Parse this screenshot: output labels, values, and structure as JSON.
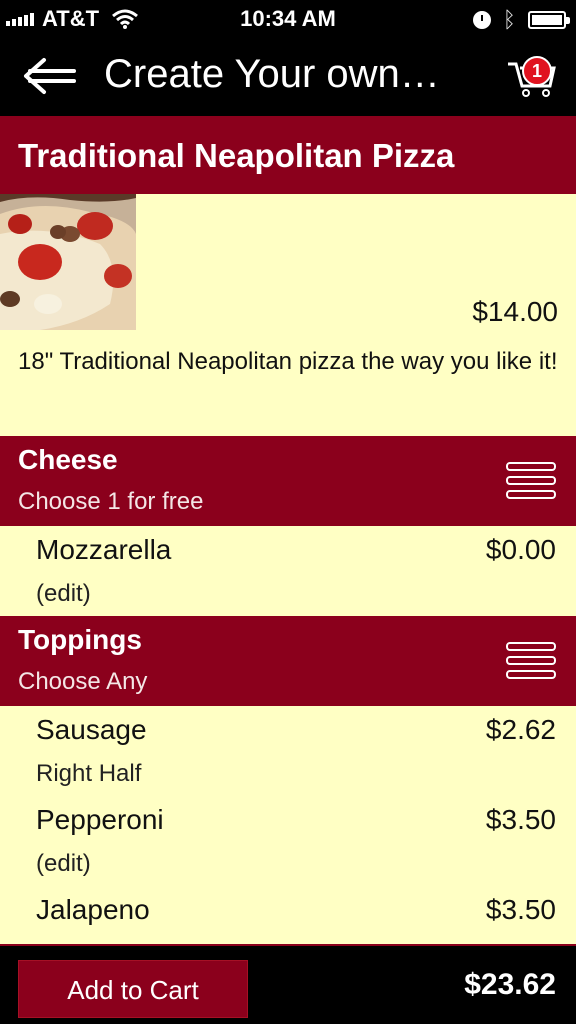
{
  "status_bar": {
    "carrier": "AT&T",
    "time": "10:34 AM"
  },
  "nav": {
    "title": "Create Your own…",
    "cart_count": "1"
  },
  "product": {
    "name": "Traditional Neapolitan Pizza",
    "price": "$14.00",
    "description": "18\" Traditional Neapolitan pizza the way you like it!"
  },
  "sections": [
    {
      "title": "Cheese",
      "subtitle": "Choose 1 for free",
      "options": [
        {
          "name": "Mozzarella",
          "sub": "(edit)",
          "price": "$0.00"
        }
      ]
    },
    {
      "title": "Toppings",
      "subtitle": "Choose Any",
      "options": [
        {
          "name": "Sausage",
          "sub": "Right Half",
          "price": "$2.62"
        },
        {
          "name": "Pepperoni",
          "sub": "(edit)",
          "price": "$3.50"
        },
        {
          "name": "Jalapeno",
          "sub": "",
          "price": "$3.50"
        }
      ]
    }
  ],
  "footer": {
    "add_label": "Add to Cart",
    "total": "$23.62"
  },
  "icons": [
    "back-arrow-icon",
    "cart-icon",
    "menu-icon",
    "wifi-icon",
    "alarm-icon",
    "bluetooth-icon",
    "battery-icon"
  ],
  "colors": {
    "accent": "#8b001c",
    "background": "#ffffc4",
    "badge": "#e0131f"
  }
}
